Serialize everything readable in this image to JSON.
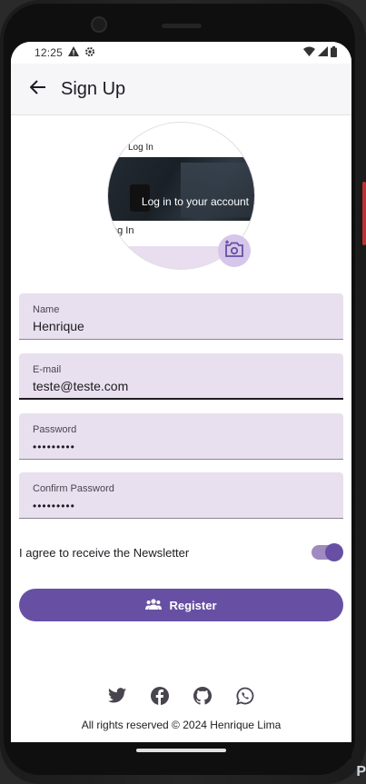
{
  "status": {
    "time": "12:25"
  },
  "app_bar": {
    "title": "Sign Up"
  },
  "avatar": {
    "top_label": "Log In",
    "photo_caption": "Log in to your account",
    "bottom_label": "og In"
  },
  "form": {
    "name": {
      "label": "Name",
      "value": "Henrique"
    },
    "email": {
      "label": "E-mail",
      "value": "teste@teste.com"
    },
    "password": {
      "label": "Password",
      "value": "•••••••••"
    },
    "confirm_password": {
      "label": "Confirm Password",
      "value": "•••••••••"
    },
    "newsletter": {
      "label": "I agree to receive the Newsletter",
      "enabled": true
    },
    "register_label": "Register"
  },
  "social": [
    "twitter-icon",
    "facebook-icon",
    "github-icon",
    "whatsapp-icon"
  ],
  "footer": {
    "text": "All rights reserved © 2024 Henrique Lima"
  },
  "colors": {
    "primary": "#6750a4",
    "field_bg": "#e8e0ee",
    "toggle_track": "#9f8bc0"
  },
  "corner_text": "P"
}
